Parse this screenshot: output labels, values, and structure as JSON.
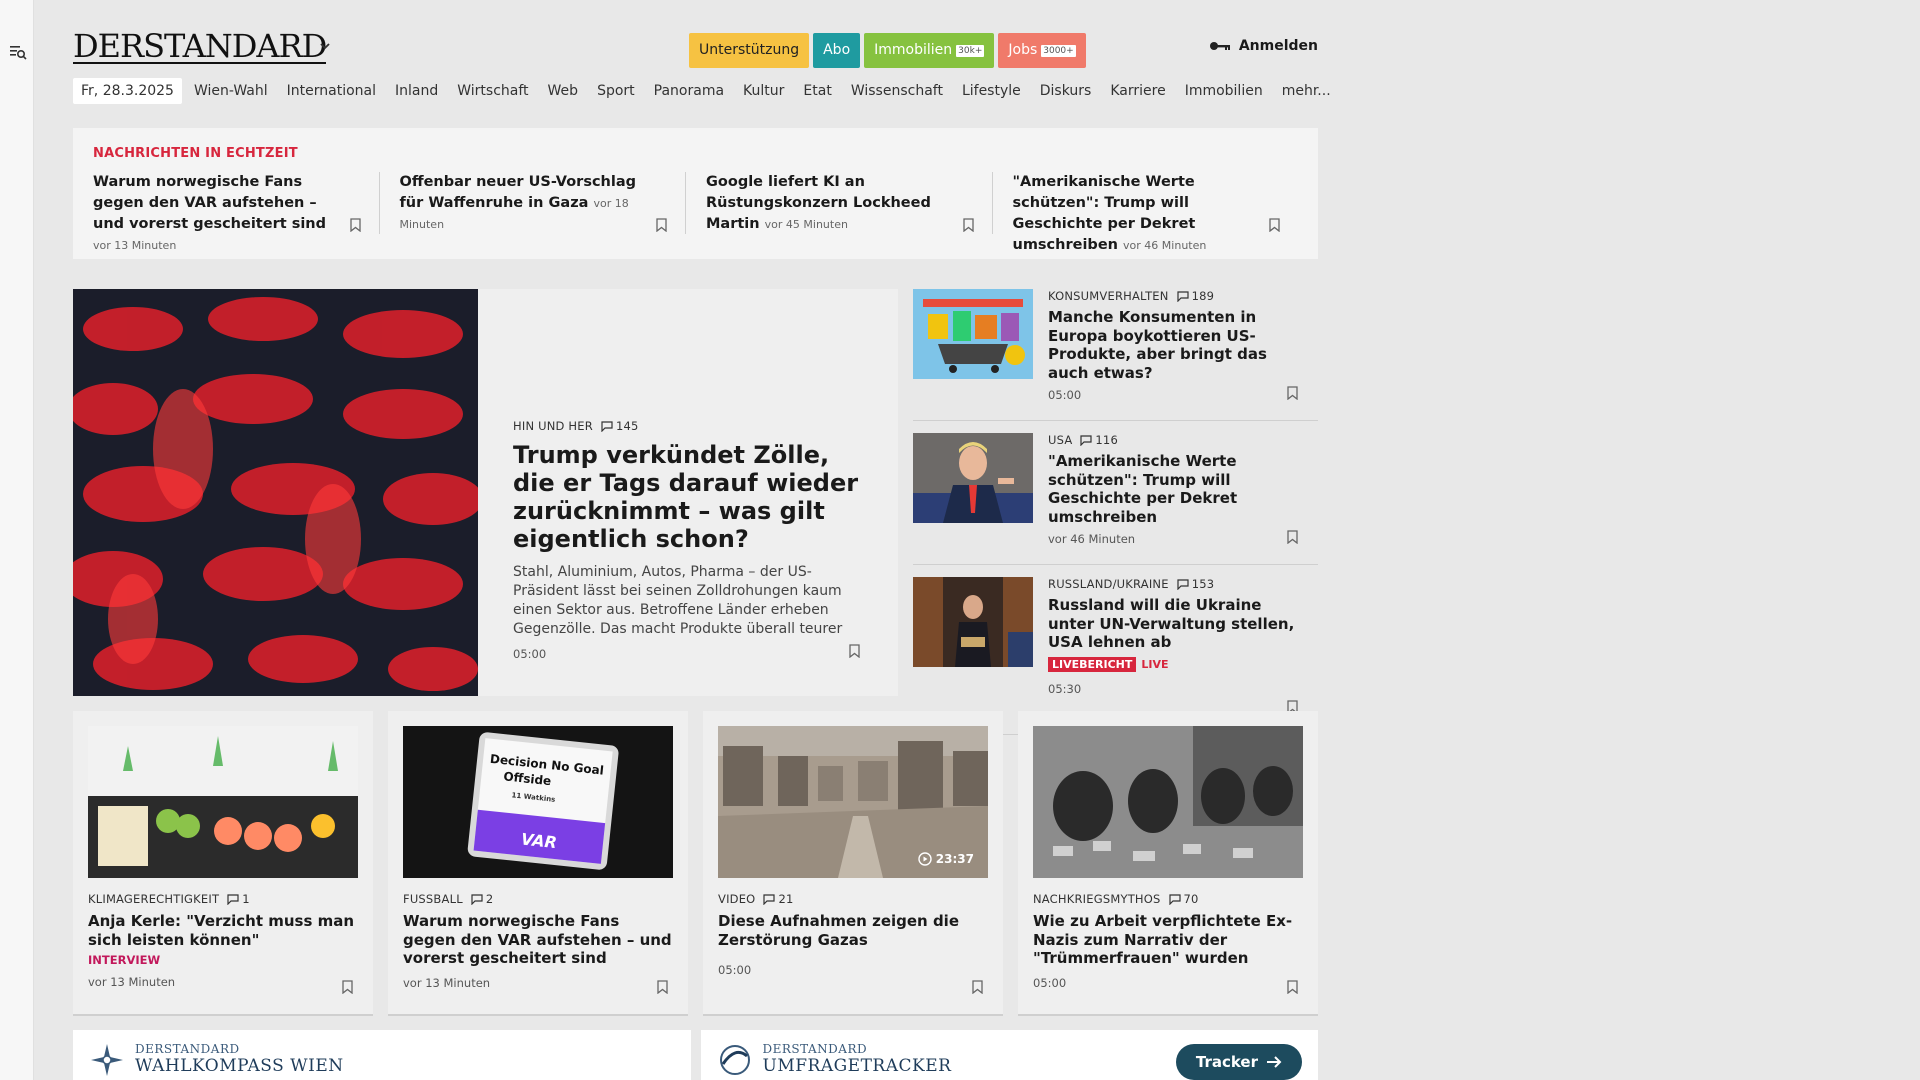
{
  "header": {
    "logo": "DERSTANDARD",
    "pills": [
      {
        "label": "Unterstützung"
      },
      {
        "label": "Abo"
      },
      {
        "label": "Immobilien",
        "badge": "30k+"
      },
      {
        "label": "Jobs",
        "badge": "3000+"
      }
    ],
    "login": "Anmelden"
  },
  "nav": {
    "date": "Fr, 28.3.2025",
    "items": [
      "Wien-Wahl",
      "International",
      "Inland",
      "Wirtschaft",
      "Web",
      "Sport",
      "Panorama",
      "Kultur",
      "Etat",
      "Wissenschaft",
      "Lifestyle",
      "Diskurs",
      "Karriere",
      "Immobilien",
      "mehr..."
    ]
  },
  "ticker": {
    "title": "NACHRICHTEN IN ECHTZEIT",
    "items": [
      {
        "title": "Warum norwegische Fans gegen den VAR aufstehen – und vorerst gescheitert sind",
        "ago": "vor 13 Minuten"
      },
      {
        "title": "Offenbar neuer US-Vorschlag für Waffenruhe in Gaza",
        "ago": "vor 18 Minuten"
      },
      {
        "title": "Google liefert KI an Rüstungskonzern Lockheed Martin",
        "ago": "vor 45 Minuten"
      },
      {
        "title": "\"Amerikanische Werte schützen\": Trump will Geschichte per Dekret umschreiben",
        "ago": "vor 46 Minuten"
      }
    ]
  },
  "lead": {
    "kicker": "HIN UND HER",
    "comments": "145",
    "title": "Trump verkündet Zölle, die er Tags darauf wieder zurücknimmt – was gilt eigentlich schon?",
    "teaser": "Stahl, Aluminium, Autos, Pharma – der US-Präsident lässt bei seinen Zolldrohungen kaum einen Sektor aus. Betroffene Länder erheben Gegenzölle. Das macht Produkte überall teurer",
    "time": "05:00"
  },
  "side": [
    {
      "kicker": "KONSUMVERHALTEN",
      "comments": "189",
      "title": "Manche Konsumenten in Europa boykottieren US-Produkte, aber bringt das auch etwas?",
      "time": "05:00"
    },
    {
      "kicker": "USA",
      "comments": "116",
      "title": "\"Amerikanische Werte schützen\": Trump will Geschichte per Dekret umschreiben",
      "time": "vor 46 Minuten"
    },
    {
      "kicker": "RUSSLAND/UKRAINE",
      "comments": "153",
      "title": "Russland will die Ukraine unter UN-Verwaltung stellen, USA lehnen ab",
      "live_badge": "LIVEBERICHT",
      "live_text": "LIVE",
      "time": "05:30"
    }
  ],
  "grid": [
    {
      "kicker": "KLIMAGERECHTIGKEIT",
      "comments": "1",
      "title": "Anja Kerle: \"Verzicht muss man sich leisten können\"",
      "tag": "INTERVIEW",
      "time": "vor 13 Minuten"
    },
    {
      "kicker": "FUSSBALL",
      "comments": "2",
      "title": "Warum norwegische Fans gegen den VAR aufstehen – und vorerst gescheitert sind",
      "time": "vor 13 Minuten",
      "img_text": [
        "Decision No Goal",
        "Offside",
        "11 Watkins",
        "VAR"
      ]
    },
    {
      "kicker": "VIDEO",
      "comments": "21",
      "title": "Diese Aufnahmen zeigen die Zerstörung Gazas",
      "time": "05:00",
      "video_duration": "23:37"
    },
    {
      "kicker": "NACHKRIEGSMYTHOS",
      "comments": "70",
      "title": "Wie zu Arbeit verpflichtete Ex-Nazis zum Narrativ der \"Trümmerfrauen\" wurden",
      "time": "05:00"
    }
  ],
  "bottom": [
    {
      "brand": "DERSTANDARD",
      "name": "WAHLKOMPASS WIEN"
    },
    {
      "brand": "DERSTANDARD",
      "name": "UMFRAGETRACKER",
      "button": "Tracker"
    }
  ]
}
